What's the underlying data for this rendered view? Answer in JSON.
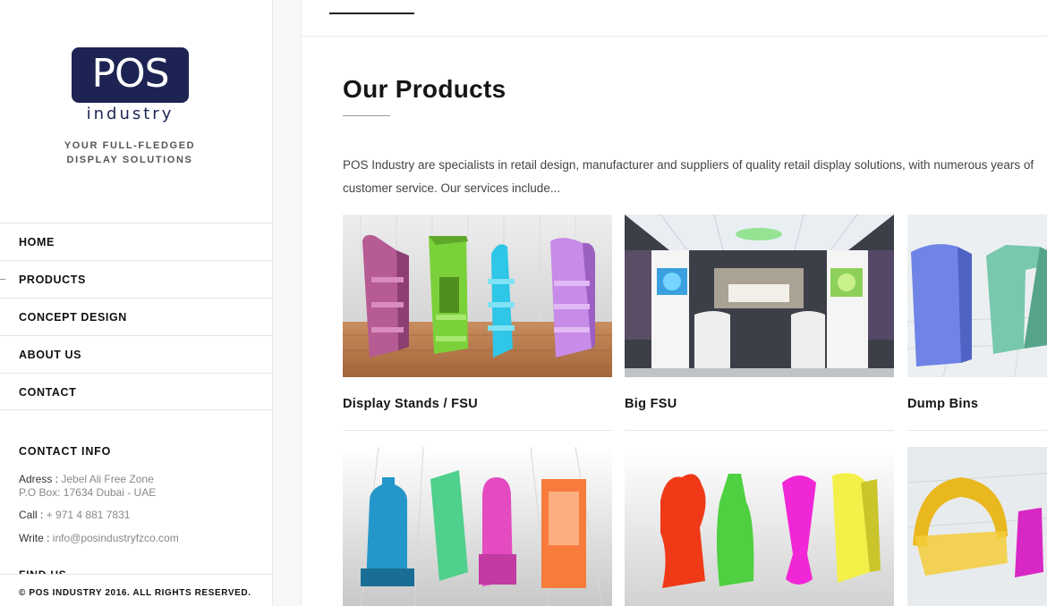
{
  "brand": {
    "logo_text": "POS",
    "logo_sub": "industry",
    "tagline_line1": "YOUR FULL-FLEDGED",
    "tagline_line2": "DISPLAY SOLUTIONS",
    "logo_color": "#1d2453"
  },
  "nav": {
    "items": [
      {
        "label": "HOME"
      },
      {
        "label": "PRODUCTS"
      },
      {
        "label": "CONCEPT DESIGN"
      },
      {
        "label": "ABOUT US"
      },
      {
        "label": "CONTACT"
      }
    ]
  },
  "contact": {
    "title": "CONTACT INFO",
    "address_label": "Adress :",
    "address_line1": "Jebel Ali Free Zone",
    "address_line2": "P.O Box: 17634 Dubai - UAE",
    "call_label": "Call :",
    "call_value": "+ 971 4 881 7831",
    "write_label": "Write :",
    "write_value": "info@posindustryfzco.com",
    "find_us": "FIND US"
  },
  "footer": {
    "copyright": "© POS INDUSTRY 2016. ALL RIGHTS RESERVED."
  },
  "main": {
    "title": "Our Products",
    "intro_line1": "POS Industry are specialists in retail design, manufacturer and suppliers of quality retail display solutions, with numerous years of",
    "intro_line2": "customer service. Our services include...",
    "products": [
      {
        "label": "Display Stands / FSU"
      },
      {
        "label": "Big FSU"
      },
      {
        "label": "Dump Bins"
      }
    ]
  }
}
